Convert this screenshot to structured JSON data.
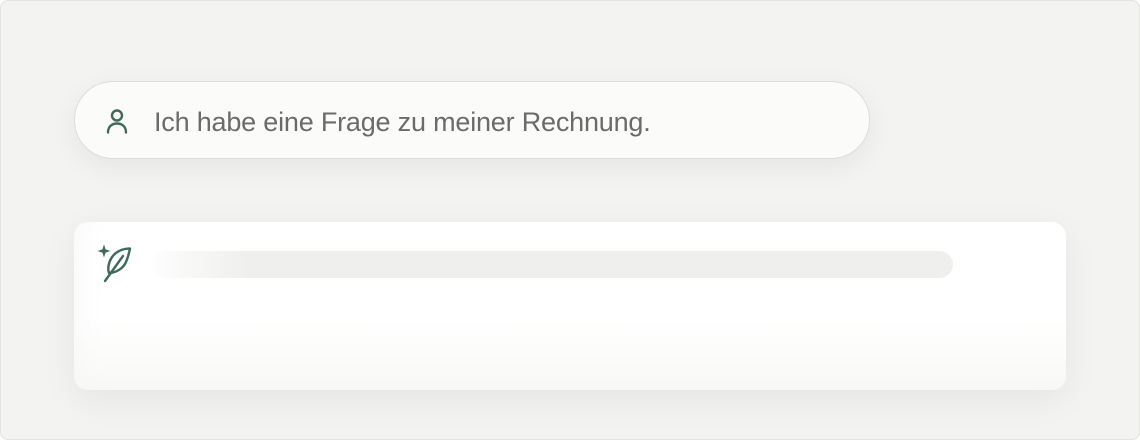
{
  "conversation": {
    "user_message": {
      "text": "Ich habe eine Frage zu meiner Rechnung.",
      "icon": "user-icon"
    },
    "assistant_message": {
      "icon": "sparkle-quill-icon",
      "state": "loading",
      "loading_progress": 0.12
    }
  },
  "colors": {
    "background": "#f3f3f1",
    "accent_icon": "#3f6a5a",
    "text": "#6a6c69",
    "skeleton": "#efefed"
  }
}
